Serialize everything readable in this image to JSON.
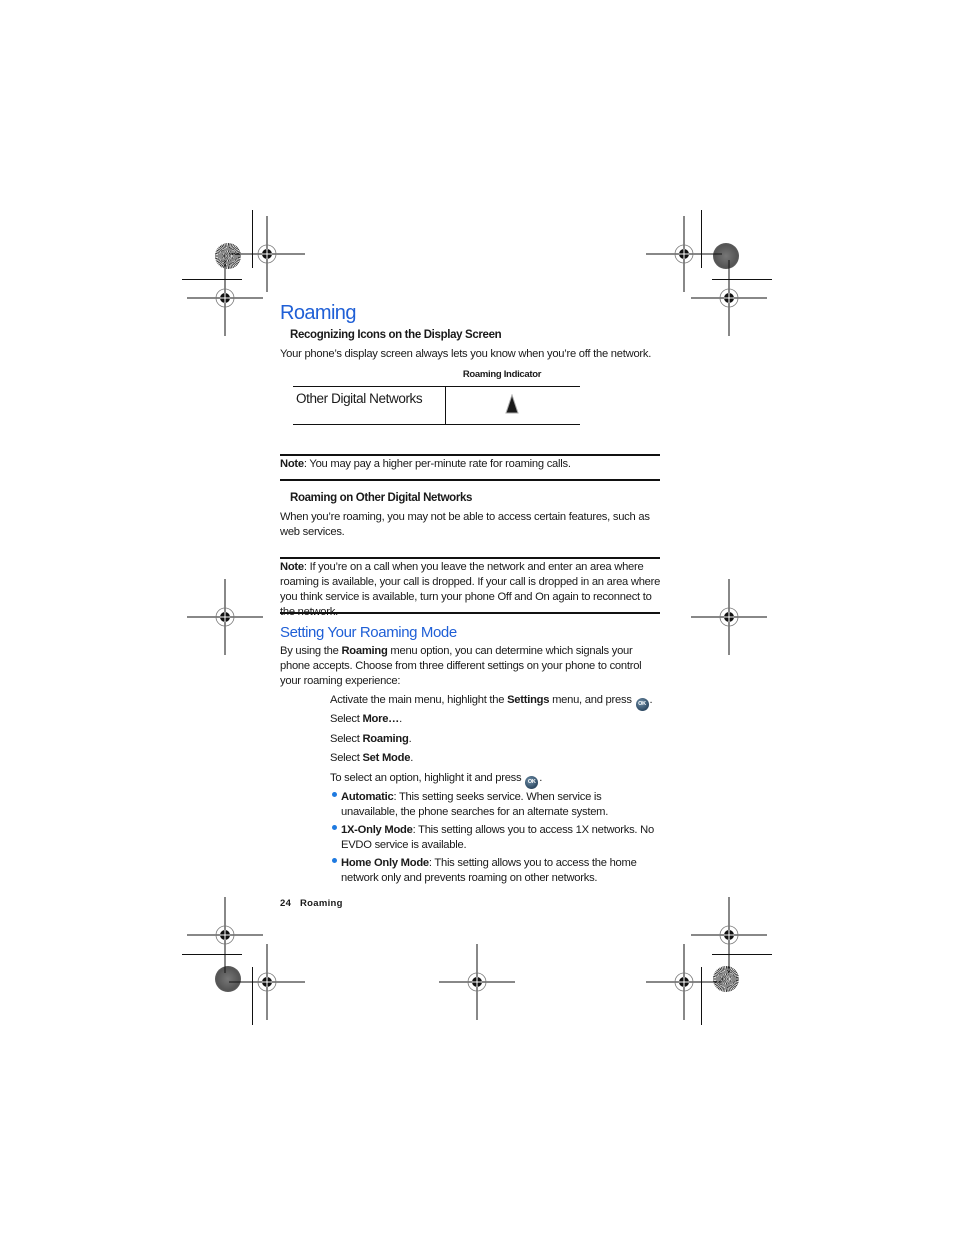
{
  "page": {
    "title": "Roaming",
    "section1": {
      "heading": "Recognizing Icons on the Display Screen",
      "intro": "Your phone’s display screen always lets you know when you’re off the network."
    },
    "table": {
      "column_header": "Roaming Indicator",
      "rows": [
        {
          "label": "Other Digital Networks",
          "icon": "roaming-triangle-icon"
        }
      ]
    },
    "note1": {
      "label": "Note",
      "text": ": You may pay a higher per-minute rate for roaming calls."
    },
    "section2": {
      "heading": "Roaming on Other Digital Networks",
      "text": "When you’re roaming, you may not be able to access certain features, such as web services."
    },
    "note2": {
      "label": "Note",
      "text": ": If you’re on a call when you leave the network and enter an area where roaming is available, your call is dropped. If your call is dropped in an area where you think service is available, turn your phone Off and On again to reconnect to the network."
    },
    "section3": {
      "heading": "Setting Your Roaming Mode",
      "intro_pre": "By using the ",
      "intro_bold": "Roaming",
      "intro_post": " menu option, you can determine which signals your phone accepts. Choose from three different settings on your phone to control your roaming experience:",
      "steps": [
        {
          "pre": "Activate the main menu, highlight the ",
          "bold": "Settings",
          "post": " menu, and press ",
          "ok": true,
          "end": "."
        },
        {
          "pre": "Select ",
          "bold": "More…",
          "post": ".",
          "ok": false,
          "end": ""
        },
        {
          "pre": "Select ",
          "bold": "Roaming",
          "post": ".",
          "ok": false,
          "end": ""
        },
        {
          "pre": "Select ",
          "bold": "Set Mode",
          "post": ".",
          "ok": false,
          "end": ""
        },
        {
          "pre": "To select an option, highlight it and press ",
          "bold": "",
          "post": "",
          "ok": true,
          "end": "."
        }
      ],
      "ok_label": "OK",
      "options": [
        {
          "bold": "Automatic",
          "text": ": This setting seeks service. When service is unavailable, the phone searches for an alternate system."
        },
        {
          "bold": "1X-Only Mode",
          "text": ": This setting allows you to access 1X networks. No EVDO service is available."
        },
        {
          "bold": "Home Only Mode",
          "text": ": This setting allows you to access the home network only and prevents roaming on other networks."
        }
      ]
    },
    "footer": {
      "page_number": "24",
      "section": "Roaming"
    },
    "colors": {
      "heading_blue": "#1f5fd6",
      "bullet_blue": "#1f7ae0",
      "rule": "#111111"
    }
  }
}
